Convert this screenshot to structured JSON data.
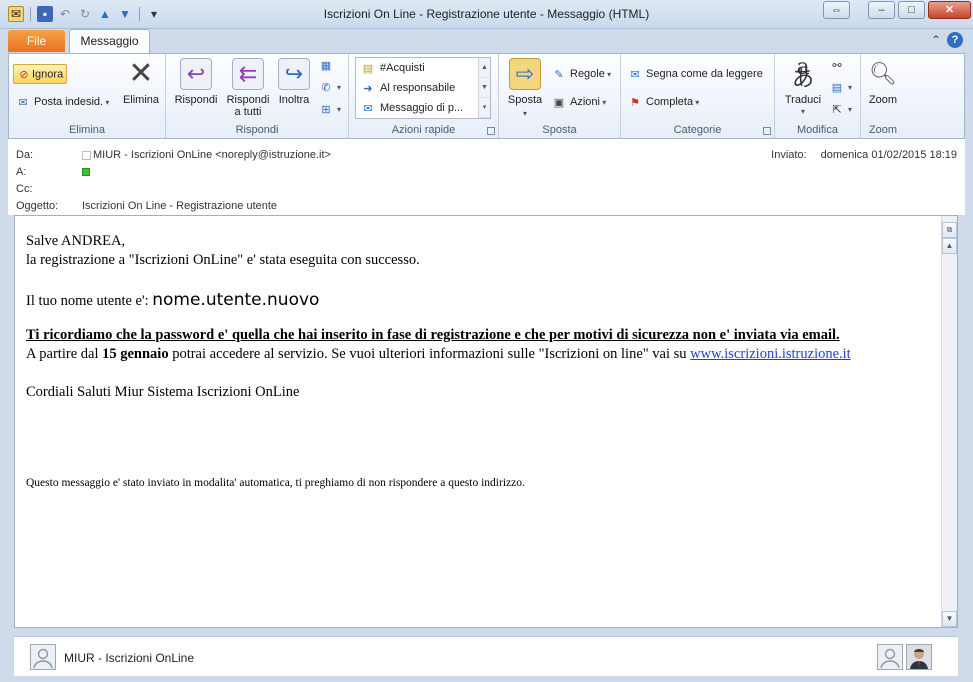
{
  "window": {
    "title": "Iscrizioni On Line - Registrazione utente  -  Messaggio (HTML)",
    "minimize": "–",
    "maximize": "□",
    "close": "✕"
  },
  "tabs": {
    "file": "File",
    "message": "Messaggio"
  },
  "ribbon": {
    "elimina": {
      "group": "Elimina",
      "ignora": "Ignora",
      "posta_indesid": "Posta indesid.",
      "elimina": "Elimina"
    },
    "rispondi": {
      "group": "Rispondi",
      "rispondi": "Rispondi",
      "rispondi_tutti_1": "Rispondi",
      "rispondi_tutti_2": "a tutti",
      "inoltra": "Inoltra"
    },
    "azioni_rapide": {
      "group": "Azioni rapide",
      "items": [
        "#Acquisti",
        "Al responsabile",
        "Messaggio di p..."
      ]
    },
    "sposta": {
      "group": "Sposta",
      "sposta": "Sposta",
      "regole": "Regole",
      "azioni": "Azioni"
    },
    "categorie": {
      "group": "Categorie",
      "segna": "Segna come da leggere",
      "completa": "Completa"
    },
    "modifica": {
      "group": "Modifica",
      "traduci": "Traduci"
    },
    "zoom": {
      "group": "Zoom",
      "zoom": "Zoom"
    }
  },
  "header": {
    "da_label": "Da:",
    "da_value": "MIUR - Iscrizioni OnLine <noreply@istruzione.it>",
    "a_label": "A:",
    "cc_label": "Cc:",
    "oggetto_label": "Oggetto:",
    "oggetto_value": "Iscrizioni On Line - Registrazione utente",
    "inviato_label": "Inviato:",
    "inviato_value": "domenica 01/02/2015 18:19"
  },
  "message": {
    "greeting": "Salve ANDREA,",
    "line1": "la registrazione a \"Iscrizioni OnLine\" e' stata eseguita con successo.",
    "username_label": "Il tuo nome utente e': ",
    "username_value": "nome.utente.nuovo",
    "password_note": "Ti ricordiamo che la password e' quella che hai inserito in fase di registrazione e che per motivi di sicurezza non e' inviata via email.",
    "access_pre": "A partire dal ",
    "access_date": "15 gennaio",
    "access_post": " potrai accedere al servizio. Se vuoi ulteriori informazioni sulle \"Iscrizioni on line\" vai su ",
    "link": "www.iscrizioni.istruzione.it",
    "signature": "Cordiali Saluti Miur Sistema Iscrizioni OnLine",
    "footer": "Questo messaggio e' stato inviato in modalita' automatica, ti preghiamo di non rispondere a questo indirizzo."
  },
  "people_pane": {
    "name": "MIUR - Iscrizioni OnLine"
  },
  "colors": {
    "accent_file": "#e8741c",
    "link": "#1f3fd9"
  }
}
